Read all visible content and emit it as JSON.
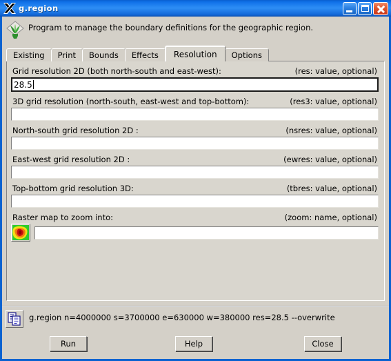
{
  "window": {
    "title": "g.region",
    "app_icon": "x-window-logo-icon",
    "buttons": {
      "minimize": "minimize-icon",
      "maximize": "maximize-icon",
      "close": "close-icon"
    },
    "accent_color": "#0a62d0",
    "face_color": "#d4d0c8"
  },
  "description": {
    "icon": "grass-gis-logo-icon",
    "text": "Program to manage the boundary definitions for the geographic region."
  },
  "tabs": [
    {
      "label": "Existing",
      "active": false
    },
    {
      "label": "Print",
      "active": false
    },
    {
      "label": "Bounds",
      "active": false
    },
    {
      "label": "Effects",
      "active": false
    },
    {
      "label": "Resolution",
      "active": true
    },
    {
      "label": "Options",
      "active": false
    }
  ],
  "fields": [
    {
      "label": "Grid resolution 2D (both north-south and east-west):",
      "hint": "(res:  value, optional)",
      "value": "28.5",
      "focused": true
    },
    {
      "label": "3D grid resolution (north-south, east-west and top-bottom):",
      "hint": "(res3:  value, optional)",
      "value": "",
      "focused": false
    },
    {
      "label": "North-south grid resolution 2D :",
      "hint": "(nsres:  value, optional)",
      "value": "",
      "focused": false
    },
    {
      "label": "East-west grid resolution 2D :",
      "hint": "(ewres:  value, optional)",
      "value": "",
      "focused": false
    },
    {
      "label": "Top-bottom grid resolution 3D:",
      "hint": "(tbres:  value, optional)",
      "value": "",
      "focused": false
    }
  ],
  "zoom_field": {
    "label": "Raster map to zoom into:",
    "hint": "(zoom:  name, optional)",
    "value": "",
    "button_icon": "raster-map-thumbnail-icon"
  },
  "command_bar": {
    "copy_icon": "copy-icon",
    "command": "g.region n=4000000 s=3700000 e=630000 w=380000 res=28.5 --overwrite"
  },
  "buttons": {
    "run": "Run",
    "help": "Help",
    "close": "Close"
  }
}
